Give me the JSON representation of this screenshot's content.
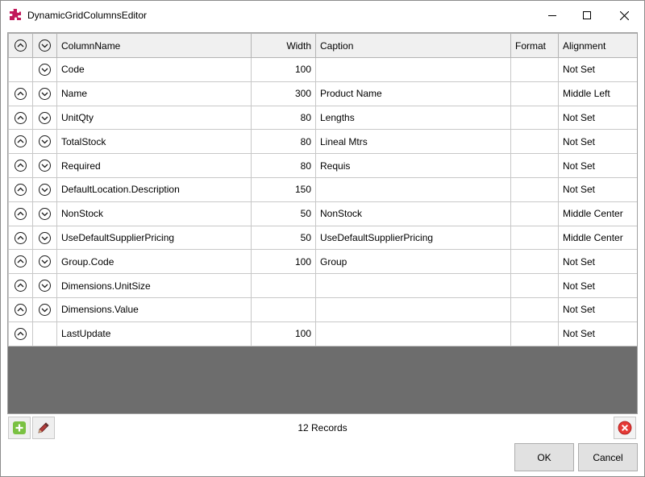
{
  "window": {
    "title": "DynamicGridColumnsEditor",
    "icon": "puzzle-icon",
    "accent": "#c2185b"
  },
  "grid": {
    "columns": [
      "ColumnName",
      "Width",
      "Caption",
      "Format",
      "Alignment"
    ],
    "rows": [
      {
        "name": "Code",
        "width": "100",
        "caption": "",
        "format": "",
        "alignment": "Not Set",
        "up": false,
        "down": true
      },
      {
        "name": "Name",
        "width": "300",
        "caption": "Product Name",
        "format": "",
        "alignment": "Middle Left",
        "up": true,
        "down": true
      },
      {
        "name": "UnitQty",
        "width": "80",
        "caption": "Lengths",
        "format": "",
        "alignment": "Not Set",
        "up": true,
        "down": true
      },
      {
        "name": "TotalStock",
        "width": "80",
        "caption": "Lineal Mtrs",
        "format": "",
        "alignment": "Not Set",
        "up": true,
        "down": true
      },
      {
        "name": "Required",
        "width": "80",
        "caption": "Requis",
        "format": "",
        "alignment": "Not Set",
        "up": true,
        "down": true
      },
      {
        "name": "DefaultLocation.Description",
        "width": "150",
        "caption": "",
        "format": "",
        "alignment": "Not Set",
        "up": true,
        "down": true
      },
      {
        "name": "NonStock",
        "width": "50",
        "caption": "NonStock",
        "format": "",
        "alignment": "Middle Center",
        "up": true,
        "down": true
      },
      {
        "name": "UseDefaultSupplierPricing",
        "width": "50",
        "caption": "UseDefaultSupplierPricing",
        "format": "",
        "alignment": "Middle Center",
        "up": true,
        "down": true
      },
      {
        "name": "Group.Code",
        "width": "100",
        "caption": "Group",
        "format": "",
        "alignment": "Not Set",
        "up": true,
        "down": true
      },
      {
        "name": "Dimensions.UnitSize",
        "width": "",
        "caption": "",
        "format": "",
        "alignment": "Not Set",
        "up": true,
        "down": true
      },
      {
        "name": "Dimensions.Value",
        "width": "",
        "caption": "",
        "format": "",
        "alignment": "Not Set",
        "up": true,
        "down": true
      },
      {
        "name": "LastUpdate",
        "width": "100",
        "caption": "",
        "format": "",
        "alignment": "Not Set",
        "up": true,
        "down": false
      }
    ],
    "empty_area_color": "#6d6d6d"
  },
  "status": {
    "records": "12 Records",
    "add_icon": "add-icon",
    "edit_icon": "edit-icon",
    "delete_icon": "delete-icon",
    "add_color": "#7ac142",
    "delete_color": "#e53935"
  },
  "buttons": {
    "ok": "OK",
    "cancel": "Cancel"
  }
}
